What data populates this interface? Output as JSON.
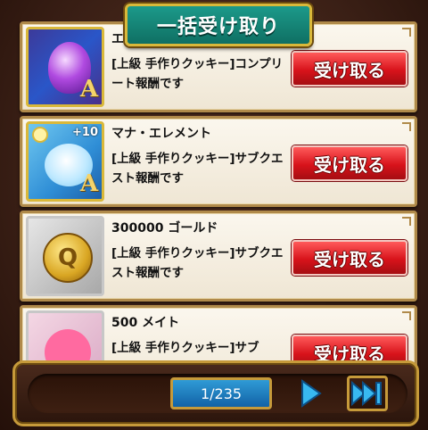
{
  "header": {
    "claim_all_label": "一括受け取り"
  },
  "rewards": [
    {
      "title": "エ",
      "description": "[上級 手作りクッキー]コンプリート報酬です",
      "claim_label": "受け取る",
      "icon": "purple-gem-icon",
      "plus": "",
      "rank": "A"
    },
    {
      "title": "マナ・エレメント",
      "description": "[上級 手作りクッキー]サブクエスト報酬です",
      "claim_label": "受け取る",
      "icon": "mana-element-icon",
      "plus": "+10",
      "rank": "A"
    },
    {
      "title": "300000 ゴールド",
      "description": "[上級 手作りクッキー]サブクエスト報酬です",
      "claim_label": "受け取る",
      "icon": "gold-coin-icon",
      "plus": "",
      "rank": ""
    },
    {
      "title": "500 メイト",
      "description": "[上級 手作りクッキー]サブ",
      "claim_label": "受け取る",
      "icon": "heart-medal-icon",
      "plus": "",
      "rank": ""
    }
  ],
  "pagination": {
    "page_label": "1/235"
  },
  "colors": {
    "claim_red": "#d8131b",
    "header_teal": "#0f6f63",
    "frame_gold": "#c69a3a"
  }
}
